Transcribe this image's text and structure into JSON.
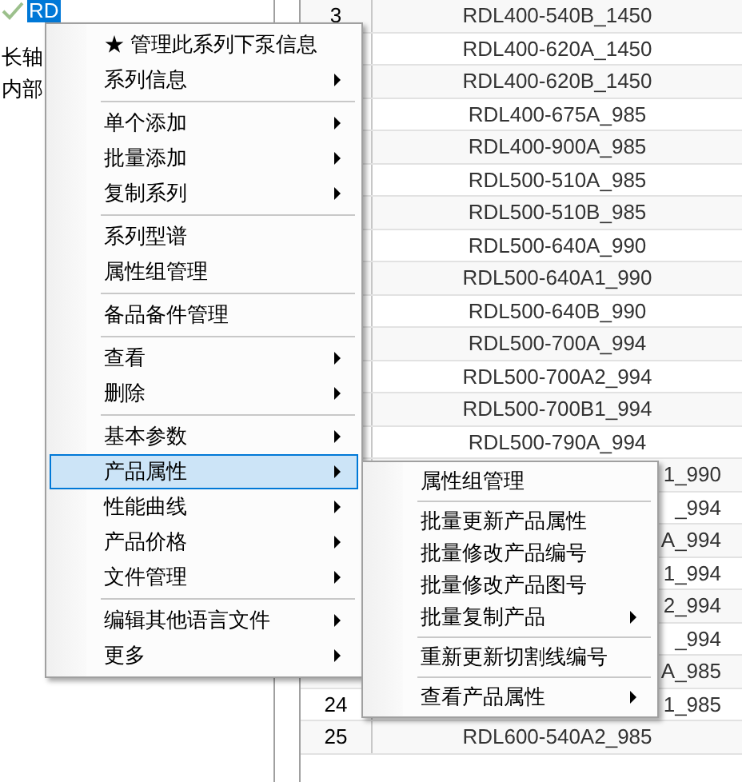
{
  "tree": {
    "items": [
      {
        "label": "RD",
        "selected": true,
        "checked": true
      },
      {
        "label": "长轴",
        "selected": false,
        "checked": false
      },
      {
        "label": "内部",
        "selected": false,
        "checked": false
      }
    ]
  },
  "table": {
    "rows": [
      {
        "number": "3",
        "name": "RDL400-540B_1450"
      },
      {
        "name": "RDL400-620A_1450"
      },
      {
        "name": "RDL400-620B_1450"
      },
      {
        "name": "RDL400-675A_985"
      },
      {
        "name": "RDL400-900A_985"
      },
      {
        "name": "RDL500-510A_985"
      },
      {
        "name": "RDL500-510B_985"
      },
      {
        "name": "RDL500-640A_990"
      },
      {
        "name": "RDL500-640A1_990"
      },
      {
        "name": "RDL500-640B_990"
      },
      {
        "name": "RDL500-700A_994"
      },
      {
        "name": "RDL500-700A2_994"
      },
      {
        "name": "RDL500-700B1_994"
      },
      {
        "name": "RDL500-790A_994"
      },
      {
        "name": "1_990",
        "kind": "partial"
      },
      {
        "name": "_994",
        "kind": "partial"
      },
      {
        "name": "A_994",
        "kind": "partial"
      },
      {
        "name": "1_994",
        "kind": "partial"
      },
      {
        "name": "2_994",
        "kind": "partial"
      },
      {
        "name": "_994",
        "kind": "partial"
      },
      {
        "name": "A_985",
        "kind": "partial"
      },
      {
        "number": "24",
        "name": "1_985",
        "kind": "partial"
      },
      {
        "number": "25",
        "name": "RDL600-540A2_985"
      }
    ]
  },
  "context_menu": {
    "items": [
      {
        "kind": "item",
        "label": "★ 管理此系列下泵信息",
        "submenu": false,
        "selected": false
      },
      {
        "kind": "item",
        "label": "系列信息",
        "submenu": true,
        "selected": false
      },
      {
        "kind": "separator"
      },
      {
        "kind": "item",
        "label": "单个添加",
        "submenu": true,
        "selected": false
      },
      {
        "kind": "item",
        "label": "批量添加",
        "submenu": true,
        "selected": false
      },
      {
        "kind": "item",
        "label": "复制系列",
        "submenu": true,
        "selected": false
      },
      {
        "kind": "separator"
      },
      {
        "kind": "item",
        "label": "系列型谱",
        "submenu": false,
        "selected": false
      },
      {
        "kind": "item",
        "label": "属性组管理",
        "submenu": false,
        "selected": false
      },
      {
        "kind": "separator"
      },
      {
        "kind": "item",
        "label": "备品备件管理",
        "submenu": false,
        "selected": false
      },
      {
        "kind": "separator"
      },
      {
        "kind": "item",
        "label": "查看",
        "submenu": true,
        "selected": false
      },
      {
        "kind": "item",
        "label": "删除",
        "submenu": true,
        "selected": false
      },
      {
        "kind": "separator"
      },
      {
        "kind": "item",
        "label": "基本参数",
        "submenu": true,
        "selected": false
      },
      {
        "kind": "item",
        "label": "产品属性",
        "submenu": true,
        "selected": true
      },
      {
        "kind": "item",
        "label": "性能曲线",
        "submenu": true,
        "selected": false
      },
      {
        "kind": "item",
        "label": "产品价格",
        "submenu": true,
        "selected": false
      },
      {
        "kind": "item",
        "label": "文件管理",
        "submenu": true,
        "selected": false
      },
      {
        "kind": "separator"
      },
      {
        "kind": "item",
        "label": "编辑其他语言文件",
        "submenu": true,
        "selected": false
      },
      {
        "kind": "item",
        "label": "更多",
        "submenu": true,
        "selected": false
      }
    ]
  },
  "submenu": {
    "items": [
      {
        "kind": "item",
        "label": "属性组管理",
        "submenu": false,
        "selected": false
      },
      {
        "kind": "separator"
      },
      {
        "kind": "item",
        "label": "批量更新产品属性",
        "submenu": false,
        "selected": false
      },
      {
        "kind": "item",
        "label": "批量修改产品编号",
        "submenu": false,
        "selected": false
      },
      {
        "kind": "item",
        "label": "批量修改产品图号",
        "submenu": false,
        "selected": false
      },
      {
        "kind": "item",
        "label": "批量复制产品",
        "submenu": true,
        "selected": false
      },
      {
        "kind": "separator"
      },
      {
        "kind": "item",
        "label": "重新更新切割线编号",
        "submenu": false,
        "selected": false
      },
      {
        "kind": "separator"
      },
      {
        "kind": "item",
        "label": "查看产品属性",
        "submenu": true,
        "selected": false
      }
    ]
  }
}
